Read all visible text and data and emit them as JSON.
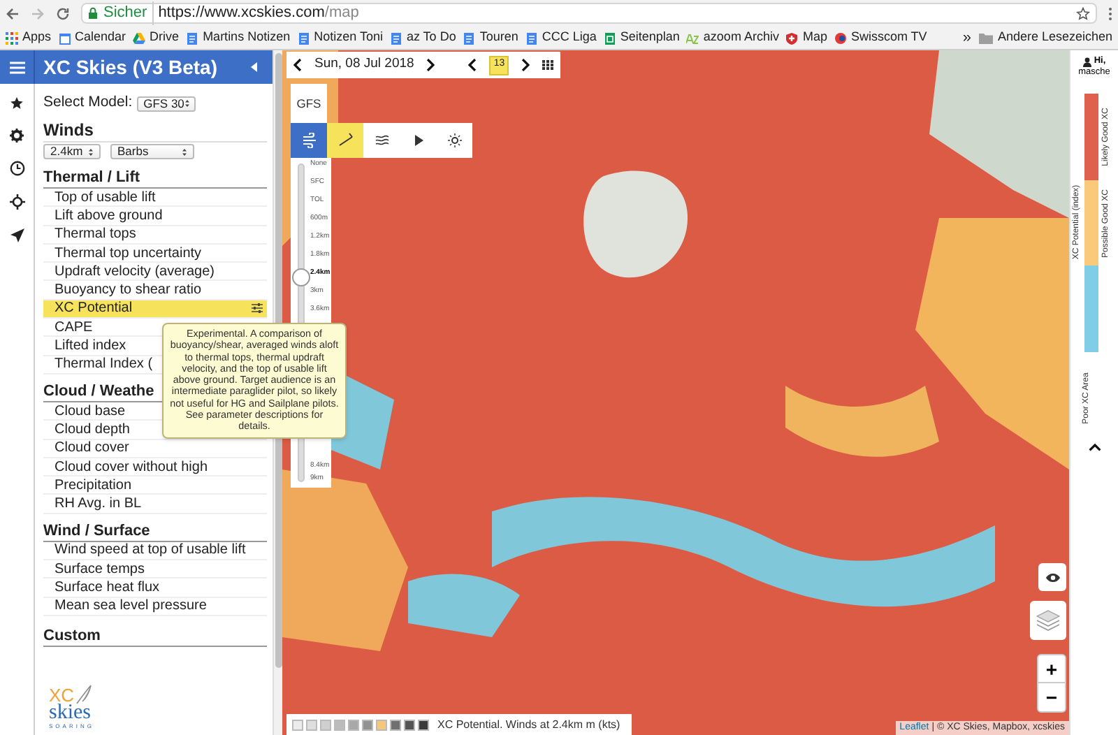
{
  "browser": {
    "security_label": "Sicher",
    "url_host": "https://www.xcskies.com",
    "url_path": "/map"
  },
  "bookmarks": [
    {
      "label": "Apps",
      "kind": "apps"
    },
    {
      "label": "Calendar",
      "kind": "calendar"
    },
    {
      "label": "Drive",
      "kind": "drive"
    },
    {
      "label": "Martins Notizen",
      "kind": "doc"
    },
    {
      "label": "Notizen Toni",
      "kind": "doc"
    },
    {
      "label": "az To Do",
      "kind": "doc"
    },
    {
      "label": "Touren",
      "kind": "doc"
    },
    {
      "label": "CCC Liga",
      "kind": "doc"
    },
    {
      "label": "Seitenplan",
      "kind": "sheet"
    },
    {
      "label": "azoom Archiv",
      "kind": "az"
    },
    {
      "label": "Map",
      "kind": "shield"
    },
    {
      "label": "Swisscom TV",
      "kind": "swisscom"
    }
  ],
  "bookmarks_more": "»",
  "other_bookmarks": "Andere Lesezeichen",
  "sidebar": {
    "title": "XC Skies (V3 Beta)",
    "model_label": "Select Model:",
    "model_value": "GFS 30",
    "winds": {
      "heading": "Winds",
      "altitude": "2.4km",
      "style": "Barbs"
    },
    "sections": [
      {
        "heading": "Thermal / Lift",
        "items": [
          {
            "label": "Top of usable lift",
            "selected": false
          },
          {
            "label": "Lift above ground",
            "selected": false
          },
          {
            "label": "Thermal tops",
            "selected": false
          },
          {
            "label": "Thermal top uncertainty",
            "selected": false
          },
          {
            "label": "Updraft velocity (average)",
            "selected": false
          },
          {
            "label": "Buoyancy to shear ratio",
            "selected": false
          },
          {
            "label": "XC Potential",
            "selected": true
          },
          {
            "label": "CAPE",
            "selected": false
          },
          {
            "label": "Lifted index",
            "selected": false
          },
          {
            "label": "Thermal Index (",
            "selected": false
          }
        ]
      },
      {
        "heading": "Cloud / Weathe",
        "items": [
          {
            "label": "Cloud base",
            "selected": false
          },
          {
            "label": "Cloud depth",
            "selected": false
          },
          {
            "label": "Cloud cover",
            "selected": false
          },
          {
            "label": "Cloud cover without high",
            "selected": false
          },
          {
            "label": "Precipitation",
            "selected": false
          },
          {
            "label": "RH Avg. in BL",
            "selected": false
          }
        ]
      },
      {
        "heading": "Wind / Surface",
        "items": [
          {
            "label": "Wind speed at top of usable lift",
            "selected": false
          },
          {
            "label": "Surface temps",
            "selected": false
          },
          {
            "label": "Surface heat flux",
            "selected": false
          },
          {
            "label": "Mean sea level pressure",
            "selected": false
          }
        ]
      },
      {
        "heading": "Custom"
      }
    ],
    "logo": {
      "top": "XC",
      "middle": "skies",
      "bottom": "SOARING"
    }
  },
  "tooltip": "Experimental. A comparison of buoyancy/shear, averaged winds aloft to thermal tops, thermal updraft velocity, and the top of usable lift above ground. Target audience is an intermediate paraglider pilot, so likely not useful for HG and Sailplane pilots. See parameter descriptions for details.",
  "map": {
    "date": "Sun, 08 Jul 2018",
    "hour": "13",
    "model_button": "GFS",
    "tools": [
      {
        "kind": "wind",
        "selected": true
      },
      {
        "kind": "barbs",
        "selected": true
      },
      {
        "kind": "lines",
        "selected": false
      },
      {
        "kind": "play",
        "selected": false
      },
      {
        "kind": "sun",
        "selected": false
      }
    ],
    "altitudes": [
      {
        "label": "None",
        "selected": false
      },
      {
        "label": "SFC",
        "selected": false
      },
      {
        "label": "TOL",
        "selected": false
      },
      {
        "label": "600m",
        "selected": false
      },
      {
        "label": "1.2km",
        "selected": false
      },
      {
        "label": "1.8km",
        "selected": false
      },
      {
        "label": "2.4km",
        "selected": true
      },
      {
        "label": "3km",
        "selected": false
      },
      {
        "label": "3.6km",
        "selected": false
      },
      {
        "label": "8.4km",
        "selected": false
      },
      {
        "label": "9km",
        "selected": false
      }
    ],
    "legend_swatches": [
      {
        "color": "#ececec"
      },
      {
        "color": "#dedede"
      },
      {
        "color": "#cfcfcf"
      },
      {
        "color": "#bcbcbc"
      },
      {
        "color": "#a8a8a8"
      },
      {
        "color": "#929292"
      },
      {
        "color": "#f4c77a"
      },
      {
        "color": "#707070"
      },
      {
        "color": "#555555"
      },
      {
        "color": "#3a3a3a"
      }
    ],
    "legend_caption": "XC Potential. Winds at 2.4km m (kts)",
    "attribution_link": "Leaflet",
    "attribution_text": "| © XC Skies, Mapbox, xcskies",
    "zoom_in": "+",
    "zoom_out": "−"
  },
  "right_panel": {
    "greeting": "Hi,",
    "user": "masche",
    "scale_title": "XC Potential (index)",
    "scale": [
      {
        "label": "Likely Good XC",
        "color": "#e0604e"
      },
      {
        "label": "Possible Good XC",
        "color": "#fbc97a"
      },
      {
        "color": "#7fcde6"
      }
    ],
    "poor_label": "Poor XC Area"
  }
}
